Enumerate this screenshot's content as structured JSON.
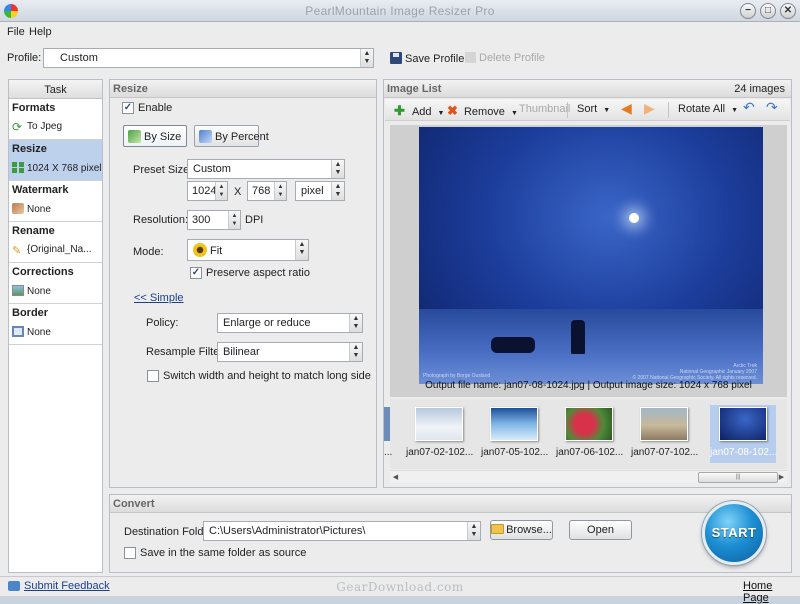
{
  "window": {
    "title": "PearlMountain Image Resizer Pro",
    "buttons": {
      "minimize": "−",
      "maximize": "□",
      "close": "✕"
    }
  },
  "menu": {
    "file": "File",
    "help": "Help"
  },
  "profile": {
    "label": "Profile:",
    "value": "Custom",
    "save_label": "Save Profile",
    "delete_label": "Delete Profile"
  },
  "task": {
    "header": "Task",
    "items": [
      {
        "title": "Formats",
        "value": "To Jpeg",
        "icon": "convert-icon"
      },
      {
        "title": "Resize",
        "value": "1024 X 768 pixel",
        "icon": "grid-icon",
        "selected": true
      },
      {
        "title": "Watermark",
        "value": "None",
        "icon": "watermark-icon"
      },
      {
        "title": "Rename",
        "value": "{Original_Na...",
        "icon": "pencil-icon"
      },
      {
        "title": "Corrections",
        "value": "None",
        "icon": "image-icon"
      },
      {
        "title": "Border",
        "value": "None",
        "icon": "border-icon"
      }
    ]
  },
  "resize": {
    "header": "Resize",
    "enable_label": "Enable",
    "enable_checked": true,
    "by_size": "By Size",
    "by_percent": "By Percent",
    "preset_label": "Preset Size:",
    "preset_value": "Custom",
    "width": "1024",
    "x_sep": "X",
    "height": "768",
    "unit": "pixel",
    "resolution_label": "Resolution:",
    "resolution_value": "300",
    "dpi_label": "DPI",
    "mode_label": "Mode:",
    "mode_value": "Fit",
    "preserve_label": "Preserve aspect ratio",
    "preserve_checked": true,
    "simple_link": "<< Simple",
    "policy_label": "Policy:",
    "policy_value": "Enlarge or reduce",
    "resample_label": "Resample Filter:",
    "resample_value": "Bilinear",
    "switch_label": "Switch width and height to match long side",
    "switch_checked": false
  },
  "image_list": {
    "header": "Image List",
    "count": "24 images",
    "toolbar": {
      "add": "Add",
      "remove": "Remove",
      "thumbnail": "Thumbnail",
      "sort": "Sort",
      "rotate_all": "Rotate All"
    },
    "preview_caption_1": "Photograph by Borge Ousland",
    "preview_caption_2": "Arctic Trek",
    "preview_caption_3": "National Geographic January 2007",
    "preview_caption_4": "© 2007 National Geographic Society. All rights reserved.",
    "output_info": "Output file name: jan07-08-1024.jpg | Output image size: 1024 x 768 pixel",
    "thumbnails": [
      {
        "caption": "jan07-02-102..."
      },
      {
        "caption": "jan07-05-102..."
      },
      {
        "caption": "jan07-06-102..."
      },
      {
        "caption": "jan07-07-102..."
      },
      {
        "caption": "jan07-08-102...",
        "selected": true
      }
    ],
    "partial_thumb_caption": "...",
    "scroll_grip": "|||"
  },
  "convert": {
    "header": "Convert",
    "dest_label": "Destination Folder:",
    "dest_value": "C:\\Users\\Administrator\\Pictures\\",
    "browse": "Browse...",
    "open": "Open",
    "same_folder_label": "Save in the same folder as source",
    "same_folder_checked": false,
    "start": "START"
  },
  "status": {
    "feedback": "Submit Feedback",
    "watermark": "GearDownload.com",
    "home": "Home Page"
  },
  "colors": {
    "selected_task": "#bdd0ec",
    "start_button": "#1d8fd4",
    "link": "#1b3f8f"
  }
}
